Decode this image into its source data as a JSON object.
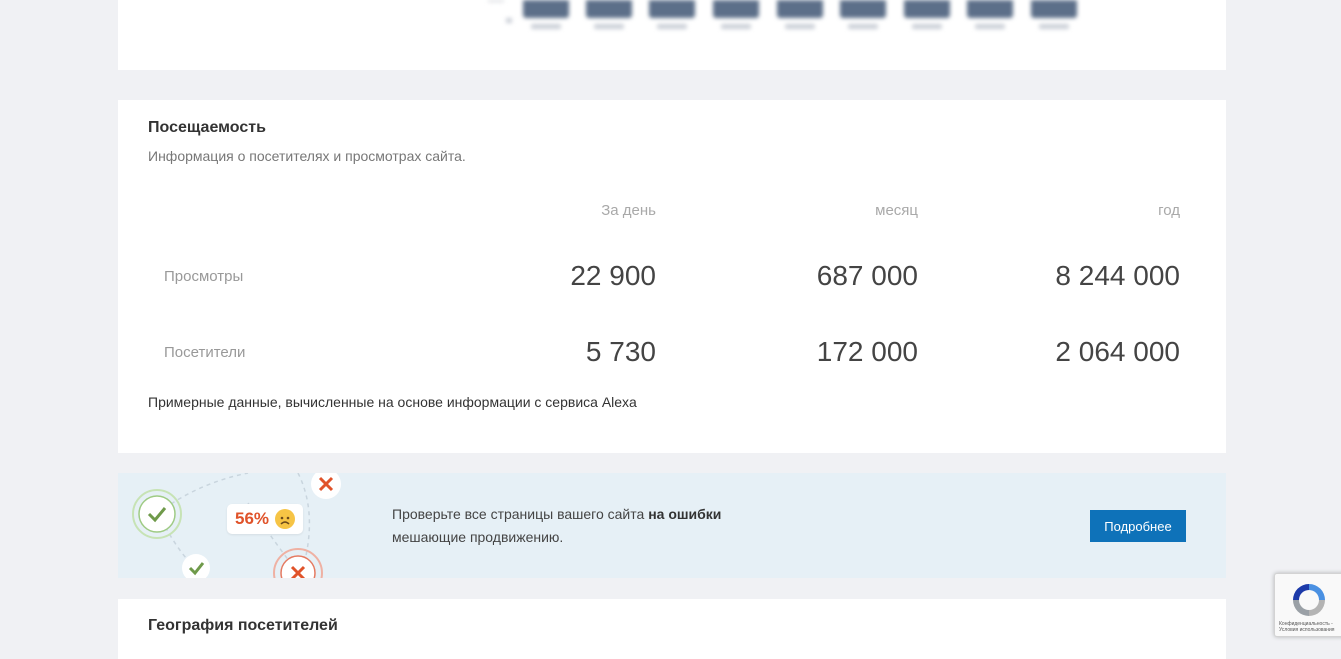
{
  "traffic": {
    "title": "Посещаемость",
    "subtitle": "Информация о посетителях и просмотрах сайта.",
    "columns": [
      "За день",
      "месяц",
      "год"
    ],
    "rows": [
      {
        "label": "Просмотры",
        "values": [
          "22 900",
          "687 000",
          "8 244 000"
        ]
      },
      {
        "label": "Посетители",
        "values": [
          "5 730",
          "172 000",
          "2 064 000"
        ]
      }
    ],
    "note": "Примерные данные, вычисленные на основе информации с сервиса Alexa"
  },
  "promo": {
    "text_before": "Проверьте все страницы вашего сайта ",
    "text_bold": "на ошибки",
    "text_line2": "мешающие продвижению.",
    "badge": "56%",
    "button_label": "Подробнее",
    "colors": {
      "accent": "#0e72b9",
      "warning": "#e0532a",
      "ok": "#6f9a4a"
    }
  },
  "geo": {
    "title": "География посетителей"
  },
  "recaptcha": {
    "icon": "recaptcha-icon",
    "line1": "Конфиденциальность -",
    "line2": "Условия использования"
  }
}
